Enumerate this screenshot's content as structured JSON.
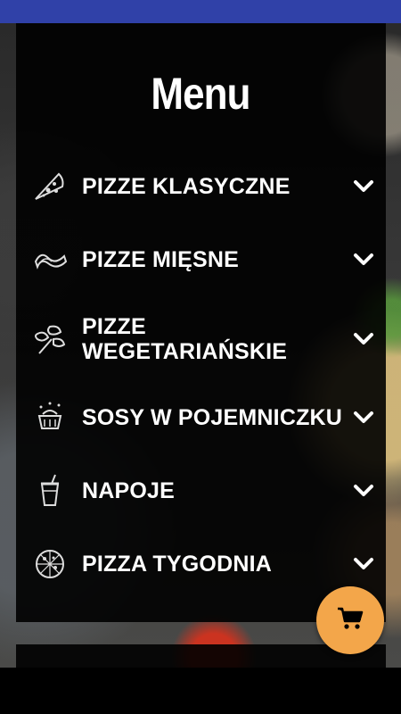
{
  "page": {
    "title": "Menu"
  },
  "menu": {
    "items": [
      {
        "label": "PIZZE KLASYCZNE",
        "icon": "pizza-slice-icon"
      },
      {
        "label": "PIZZE MIĘSNE",
        "icon": "bacon-icon"
      },
      {
        "label": "PIZZE WEGETARIAŃSKIE",
        "icon": "herb-leaf-icon"
      },
      {
        "label": "SOSY W POJEMNICZKU",
        "icon": "sauce-cup-icon"
      },
      {
        "label": "NAPOJE",
        "icon": "drink-cup-icon"
      },
      {
        "label": "PIZZA TYGODNIA",
        "icon": "whole-pizza-icon"
      }
    ]
  },
  "cart": {
    "icon": "cart-icon"
  },
  "colors": {
    "status_bar": "#3041a8",
    "fab": "#f3a64a",
    "panel": "#000000",
    "text": "#ffffff"
  }
}
